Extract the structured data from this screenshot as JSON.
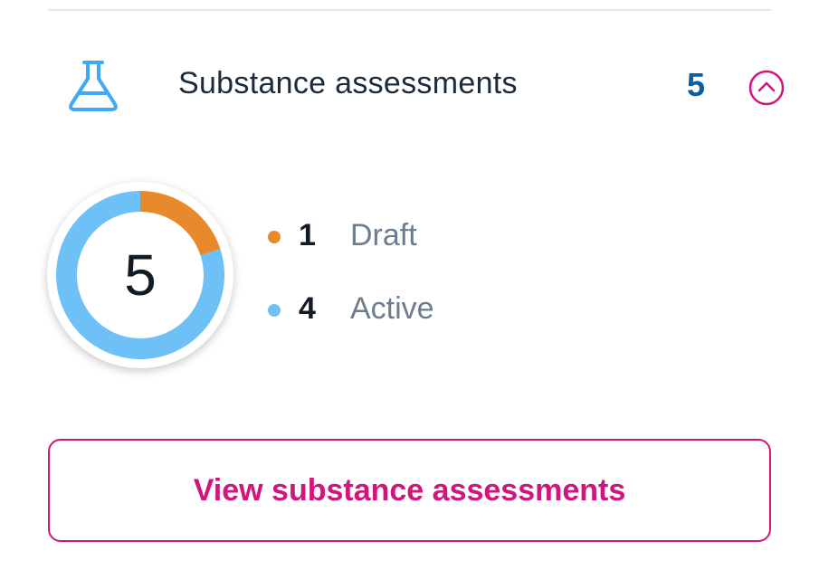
{
  "section": {
    "icon": "flask-icon",
    "title": "Substance assessments",
    "count": "5",
    "collapse_icon": "chevron-up-circle-icon"
  },
  "summary": {
    "total": "5",
    "items": [
      {
        "value": "1",
        "label": "Draft",
        "color": "#e8892b"
      },
      {
        "value": "4",
        "label": "Active",
        "color": "#6ec1f7"
      }
    ]
  },
  "chart_data": {
    "type": "pie",
    "categories": [
      "Draft",
      "Active"
    ],
    "values": [
      1,
      4
    ],
    "colors": [
      "#e8892b",
      "#6ec1f7"
    ],
    "center_label": "5"
  },
  "actions": {
    "view_label": "View substance assessments"
  },
  "colors": {
    "accent": "#d1157c",
    "count": "#0b5ea3",
    "icon": "#3fa9f5",
    "text": "#1c2b39",
    "muted": "#6c7d8e"
  }
}
